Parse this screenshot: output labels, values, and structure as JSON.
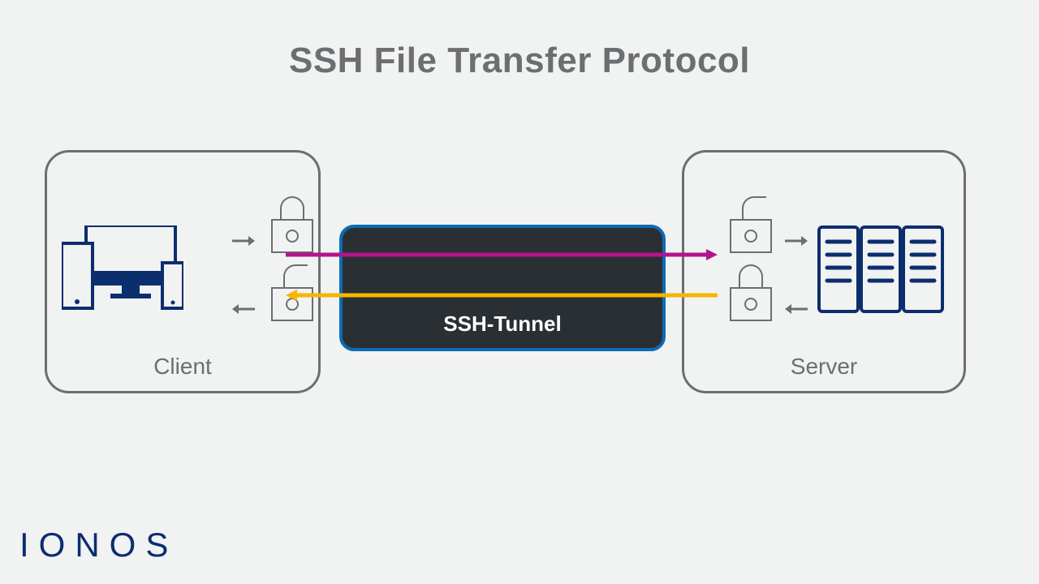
{
  "title": "SSH File Transfer Protocol",
  "logo_text": "IONOS",
  "client": {
    "label": "Client"
  },
  "server": {
    "label": "Server"
  },
  "tunnel": {
    "label": "SSH-Tunnel"
  },
  "colors": {
    "border_gray": "#6d6e71",
    "device_blue": "#0b2e6f",
    "tunnel_border": "#0b6bb5",
    "tunnel_fill": "#2a2f33",
    "arrow_magenta": "#b2158b",
    "arrow_yellow": "#f6b500"
  }
}
